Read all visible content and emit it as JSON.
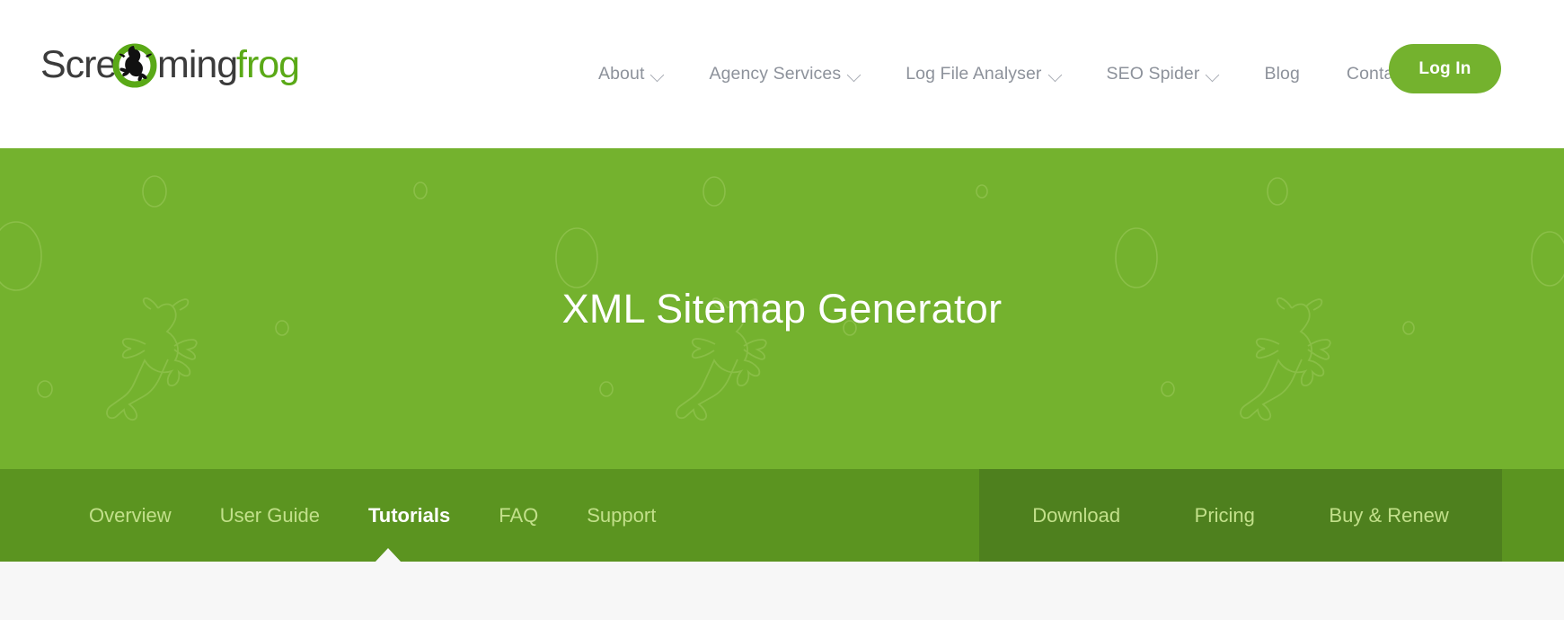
{
  "site": {
    "logo": {
      "text_part1": "Scre",
      "text_icon": "frog-in-circle-a",
      "text_part2": "ming",
      "text_part3": "frog",
      "full_text": "Screamingfrog",
      "dark_color": "#3b3b3b",
      "green_color": "#5aa917"
    }
  },
  "header": {
    "nav_items": [
      {
        "label": "About",
        "has_dropdown": true,
        "icon": "chevron-down-icon"
      },
      {
        "label": "Agency Services",
        "has_dropdown": true,
        "icon": "chevron-down-icon"
      },
      {
        "label": "Log File Analyser",
        "has_dropdown": true,
        "icon": "chevron-down-icon"
      },
      {
        "label": "SEO Spider",
        "has_dropdown": true,
        "icon": "chevron-down-icon"
      },
      {
        "label": "Blog",
        "has_dropdown": false,
        "icon": ""
      },
      {
        "label": "Contact",
        "has_dropdown": false,
        "icon": ""
      }
    ],
    "login_label": "Log In",
    "nav_text_color": "#8d929b",
    "login_bg_color": "#74b22e"
  },
  "hero": {
    "title": "XML Sitemap Generator",
    "bg_color": "#74b22e",
    "title_color": "#ffffff",
    "decorations": {
      "frog_outlines": 3,
      "circle_outlines": 14
    }
  },
  "subnav": {
    "bg_color": "#5b9420",
    "right_bg_color": "#4e801e",
    "tab_color": "#c2e08a",
    "active_tab_color": "#ffffff",
    "tabs": [
      {
        "label": "Overview",
        "active": false
      },
      {
        "label": "User Guide",
        "active": false
      },
      {
        "label": "Tutorials",
        "active": true
      },
      {
        "label": "FAQ",
        "active": false
      },
      {
        "label": "Support",
        "active": false
      }
    ],
    "actions": [
      {
        "label": "Download"
      },
      {
        "label": "Pricing"
      },
      {
        "label": "Buy & Renew"
      }
    ]
  }
}
